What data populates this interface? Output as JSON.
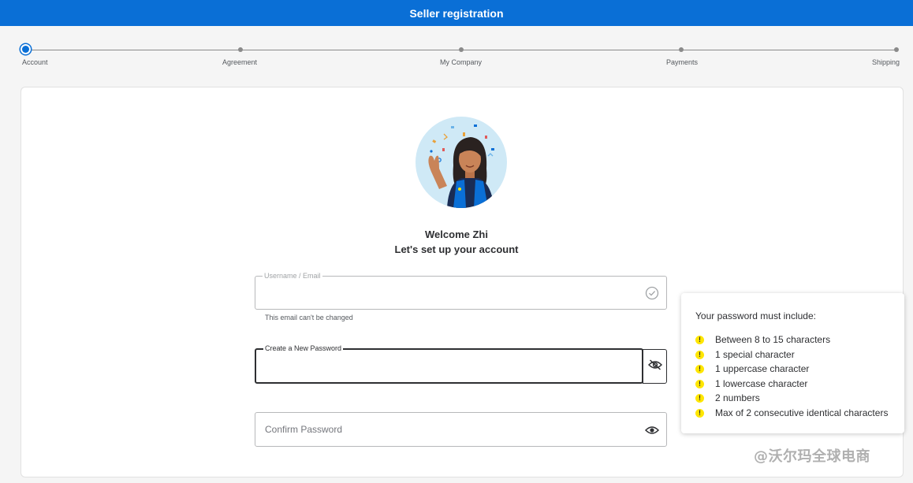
{
  "header": {
    "title": "Seller registration"
  },
  "stepper": {
    "steps": [
      {
        "label": "Account",
        "active": true
      },
      {
        "label": "Agreement",
        "active": false
      },
      {
        "label": "My Company",
        "active": false
      },
      {
        "label": "Payments",
        "active": false
      },
      {
        "label": "Shipping",
        "active": false
      }
    ]
  },
  "welcome": {
    "greeting": "Welcome Zhi",
    "subtitle": "Let's set up your account"
  },
  "username_field": {
    "label": "Username / Email",
    "value": "",
    "helper": "This email can't be changed",
    "icon": "check-circle-icon"
  },
  "new_password_field": {
    "label": "Create a New Password",
    "value": "",
    "icon": "eye-slash-icon"
  },
  "confirm_password_field": {
    "placeholder": "Confirm Password",
    "value": "",
    "icon": "eye-icon"
  },
  "password_rules": {
    "title": "Your password must include:",
    "items": [
      "Between 8 to 15 characters",
      "1 special character",
      "1 uppercase character",
      "1 lowercase character",
      "2 numbers",
      "Max of 2 consecutive identical characters"
    ],
    "warn_symbol": "!"
  },
  "watermark": "@沃尔玛全球电商",
  "colors": {
    "brand_blue": "#0a6fd6",
    "warning_yellow": "#ffe600",
    "text_dark": "#2e2f32"
  }
}
